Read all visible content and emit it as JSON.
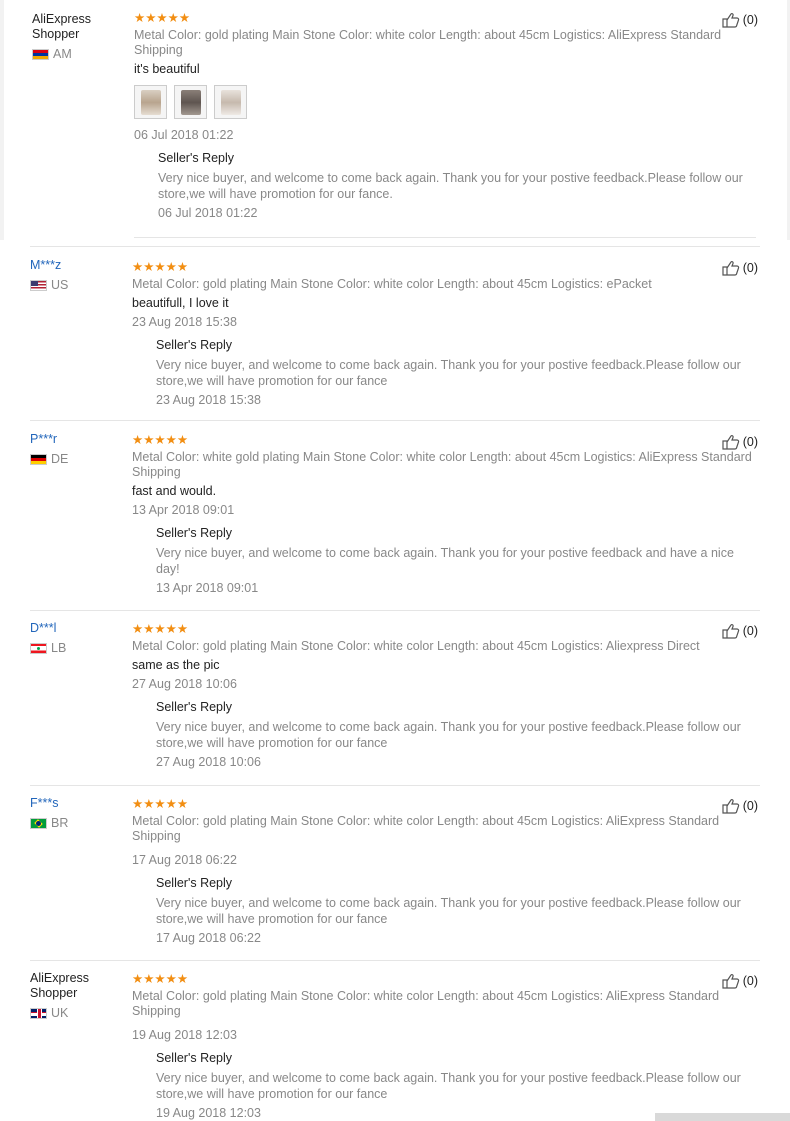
{
  "seller_reply_label": "Seller's Reply",
  "stars": "★★★★★",
  "reviews": [
    {
      "user": "AliExpress Shopper",
      "country": "AM",
      "flag": "am",
      "meta": "Metal Color: gold plating   Main Stone Color: white color   Length: about 45cm   Logistics: AliExpress Standard Shipping",
      "comment": "it's beautiful",
      "has_photos": true,
      "date": "06 Jul 2018 01:22",
      "reply": "Very nice buyer, and welcome to come back again. Thank you for your postive feedback.Please follow our store,we will have promotion for our fance.",
      "reply_date": "06 Jul 2018 01:22",
      "helpful": "(0)"
    },
    {
      "user": "M***z",
      "country": "US",
      "flag": "us",
      "meta": "Metal Color: gold plating   Main Stone Color: white color   Length: about 45cm   Logistics: ePacket",
      "comment": "beautifull, I love it",
      "has_photos": false,
      "date": "23 Aug 2018 15:38",
      "reply": "Very nice buyer, and welcome to come back again. Thank you for your postive feedback.Please follow our store,we will have promotion for our fance",
      "reply_date": "23 Aug 2018 15:38",
      "helpful": "(0)"
    },
    {
      "user": "P***r",
      "country": "DE",
      "flag": "de",
      "meta": "Metal Color: white gold plating   Main Stone Color: white color   Length: about 45cm   Logistics: AliExpress Standard Shipping",
      "comment": "fast and would.",
      "has_photos": false,
      "date": "13 Apr 2018 09:01",
      "reply": "Very nice buyer, and welcome to come back again. Thank you for your postive feedback and have a nice day!",
      "reply_date": "13 Apr 2018 09:01",
      "helpful": "(0)"
    },
    {
      "user": "D***l",
      "country": "LB",
      "flag": "lb",
      "meta": "Metal Color: gold plating   Main Stone Color: white color   Length: about 45cm   Logistics: Aliexpress Direct",
      "comment": "same as the pic",
      "has_photos": false,
      "date": "27 Aug 2018 10:06",
      "reply": "Very nice buyer, and welcome to come back again. Thank you for your postive feedback.Please follow our store,we will have promotion for our fance",
      "reply_date": "27 Aug 2018 10:06",
      "helpful": "(0)"
    },
    {
      "user": "F***s",
      "country": "BR",
      "flag": "br",
      "meta": "Metal Color: gold plating   Main Stone Color: white color   Length: about 45cm   Logistics: AliExpress Standard Shipping",
      "comment": "",
      "has_photos": false,
      "date": "17 Aug 2018 06:22",
      "reply": "Very nice buyer, and welcome to come back again. Thank you for your postive feedback.Please follow our store,we will have promotion for our fance",
      "reply_date": "17 Aug 2018 06:22",
      "helpful": "(0)"
    },
    {
      "user": "AliExpress Shopper",
      "country": "UK",
      "flag": "uk",
      "meta": "Metal Color: gold plating   Main Stone Color: white color   Length: about 45cm   Logistics: AliExpress Standard Shipping",
      "comment": "",
      "has_photos": false,
      "date": "19 Aug 2018 12:03",
      "reply": "Very nice buyer, and welcome to come back again. Thank you for your postive feedback.Please follow our store,we will have promotion for our fance",
      "reply_date": "19 Aug 2018 12:03",
      "helpful": "(0)"
    }
  ]
}
